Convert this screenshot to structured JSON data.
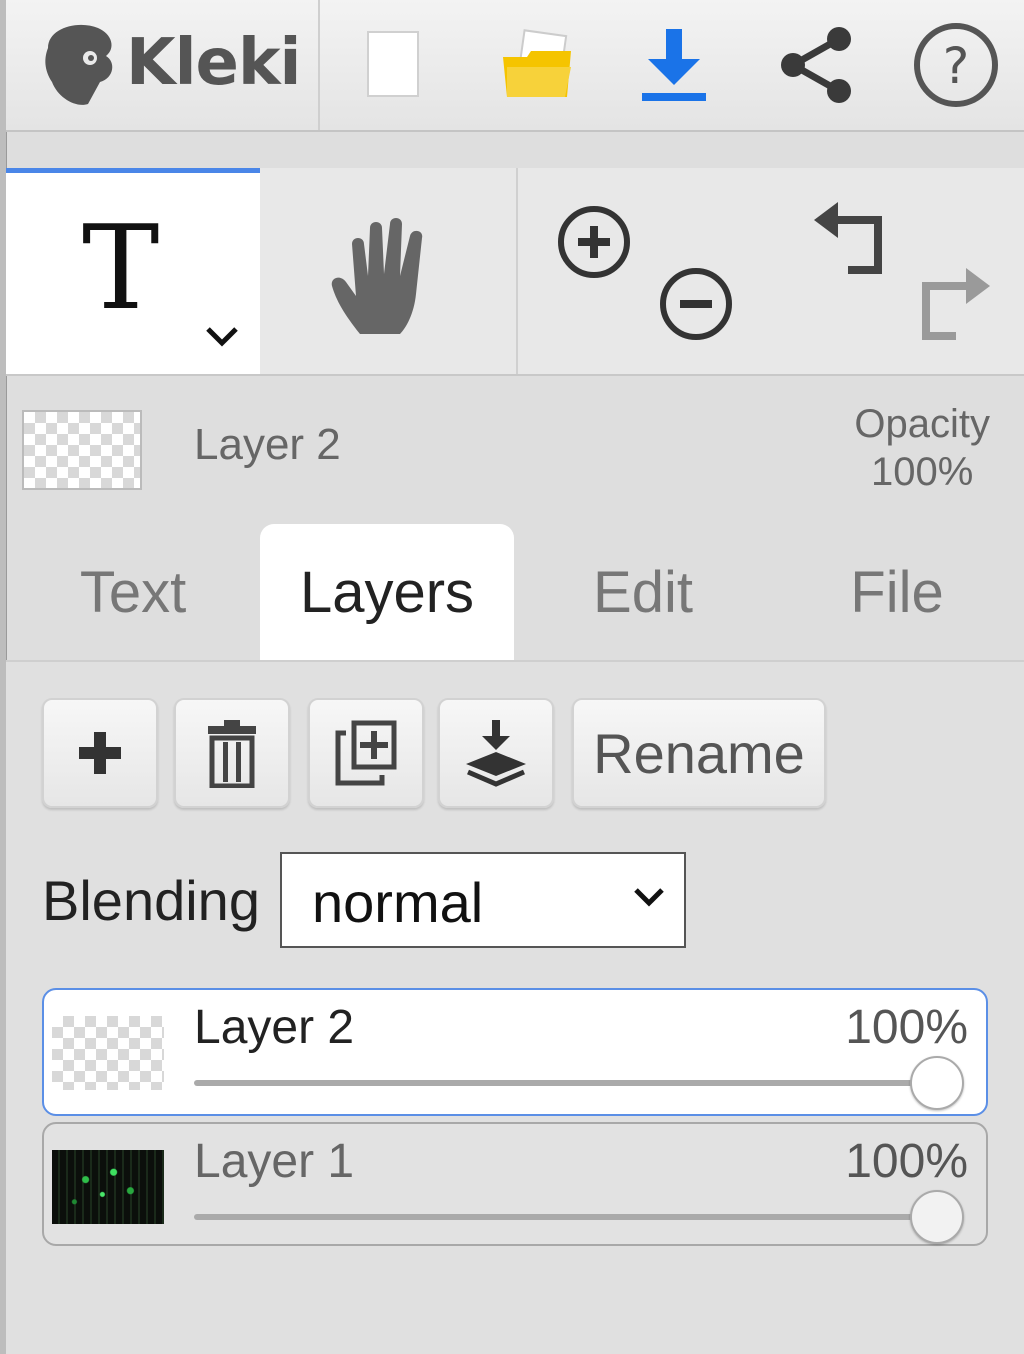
{
  "app": {
    "name": "Kleki"
  },
  "toolbar": {
    "icons": [
      "new-image-icon",
      "open-folder-icon",
      "download-icon",
      "share-icon",
      "help-icon"
    ],
    "accent_color": "#1a73e8",
    "folder_color": "#f5c400"
  },
  "tools": {
    "active": "text-tool",
    "text_tool_glyph": "T",
    "icons": [
      "hand-icon",
      "zoom-in-icon",
      "zoom-out-icon",
      "undo-icon",
      "redo-icon"
    ]
  },
  "current_layer": {
    "name": "Layer 2",
    "opacity_label": "Opacity",
    "opacity_value": "100%"
  },
  "tabs": [
    {
      "label": "Text",
      "active": false
    },
    {
      "label": "Layers",
      "active": true
    },
    {
      "label": "Edit",
      "active": false
    },
    {
      "label": "File",
      "active": false
    }
  ],
  "layers_panel": {
    "buttons": {
      "add": "plus-icon",
      "delete": "trash-icon",
      "duplicate": "duplicate-icon",
      "merge_down": "merge-down-icon",
      "rename_label": "Rename"
    },
    "blending_label": "Blending",
    "blending_value": "normal",
    "layers": [
      {
        "name": "Layer 2",
        "opacity": "100%",
        "opacity_fraction": 1.0,
        "selected": true
      },
      {
        "name": "Layer 1",
        "opacity": "100%",
        "opacity_fraction": 1.0,
        "selected": false
      }
    ]
  }
}
